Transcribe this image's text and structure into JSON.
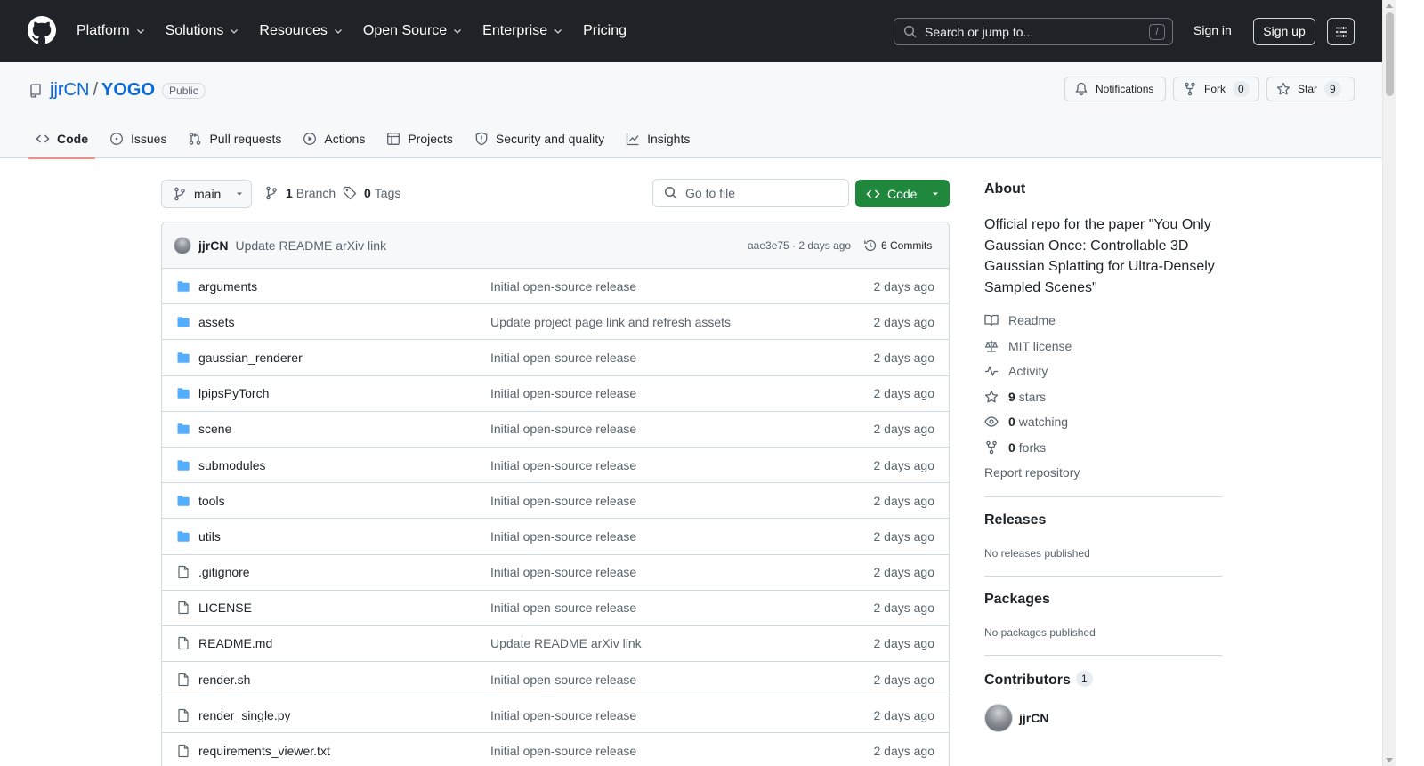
{
  "header": {
    "nav": [
      {
        "label": "Platform",
        "dropdown": true
      },
      {
        "label": "Solutions",
        "dropdown": true
      },
      {
        "label": "Resources",
        "dropdown": true
      },
      {
        "label": "Open Source",
        "dropdown": true
      },
      {
        "label": "Enterprise",
        "dropdown": true
      },
      {
        "label": "Pricing",
        "dropdown": false
      }
    ],
    "search_placeholder": "Search or jump to...",
    "search_shortcut": "/",
    "sign_in": "Sign in",
    "sign_up": "Sign up"
  },
  "repo": {
    "owner": "jjrCN",
    "separator": "/",
    "name": "YOGO",
    "visibility": "Public",
    "notifications_label": "Notifications",
    "fork_label": "Fork",
    "fork_count": "0",
    "star_label": "Star",
    "star_count": "9"
  },
  "tabs": [
    {
      "label": "Code",
      "icon": "code-icon",
      "active": true
    },
    {
      "label": "Issues",
      "icon": "issue-icon",
      "active": false
    },
    {
      "label": "Pull requests",
      "icon": "pull-request-icon",
      "active": false
    },
    {
      "label": "Actions",
      "icon": "play-icon",
      "active": false
    },
    {
      "label": "Projects",
      "icon": "table-icon",
      "active": false
    },
    {
      "label": "Security and quality",
      "icon": "shield-icon",
      "active": false
    },
    {
      "label": "Insights",
      "icon": "graph-icon",
      "active": false
    }
  ],
  "toolbar": {
    "branch": "main",
    "branch_count": "1",
    "branch_label": "Branch",
    "tag_count": "0",
    "tag_label": "Tags",
    "goto_placeholder": "Go to file",
    "code_label": "Code"
  },
  "commit": {
    "author": "jjrCN",
    "message": "Update README arXiv link",
    "hash_time": "aae3e75 · 2 days ago",
    "commits": "6 Commits"
  },
  "files": [
    {
      "name": "arguments",
      "type": "dir",
      "message": "Initial open-source release",
      "date": "2 days ago"
    },
    {
      "name": "assets",
      "type": "dir",
      "message": "Update project page link and refresh assets",
      "date": "2 days ago"
    },
    {
      "name": "gaussian_renderer",
      "type": "dir",
      "message": "Initial open-source release",
      "date": "2 days ago"
    },
    {
      "name": "lpipsPyTorch",
      "type": "dir",
      "message": "Initial open-source release",
      "date": "2 days ago"
    },
    {
      "name": "scene",
      "type": "dir",
      "message": "Initial open-source release",
      "date": "2 days ago"
    },
    {
      "name": "submodules",
      "type": "dir",
      "message": "Initial open-source release",
      "date": "2 days ago"
    },
    {
      "name": "tools",
      "type": "dir",
      "message": "Initial open-source release",
      "date": "2 days ago"
    },
    {
      "name": "utils",
      "type": "dir",
      "message": "Initial open-source release",
      "date": "2 days ago"
    },
    {
      "name": ".gitignore",
      "type": "file",
      "message": "Initial open-source release",
      "date": "2 days ago"
    },
    {
      "name": "LICENSE",
      "type": "file",
      "message": "Initial open-source release",
      "date": "2 days ago"
    },
    {
      "name": "README.md",
      "type": "file",
      "message": "Update README arXiv link",
      "date": "2 days ago"
    },
    {
      "name": "render.sh",
      "type": "file",
      "message": "Initial open-source release",
      "date": "2 days ago"
    },
    {
      "name": "render_single.py",
      "type": "file",
      "message": "Initial open-source release",
      "date": "2 days ago"
    },
    {
      "name": "requirements_viewer.txt",
      "type": "file",
      "message": "Initial open-source release",
      "date": "2 days ago"
    }
  ],
  "about": {
    "title": "About",
    "description": "Official repo for the paper \"You Only Gaussian Once: Controllable 3D Gaussian Splatting for Ultra-Densely Sampled Scenes\"",
    "items": [
      {
        "icon": "book-icon",
        "bold": "",
        "label": "Readme"
      },
      {
        "icon": "law-icon",
        "bold": "",
        "label": "MIT license"
      },
      {
        "icon": "pulse-icon",
        "bold": "",
        "label": "Activity"
      },
      {
        "icon": "star-icon",
        "bold": "9",
        "label": "stars"
      },
      {
        "icon": "eye-icon",
        "bold": "0",
        "label": "watching"
      },
      {
        "icon": "fork-icon",
        "bold": "0",
        "label": "forks"
      }
    ],
    "report": "Report repository"
  },
  "releases": {
    "title": "Releases",
    "text": "No releases published"
  },
  "packages": {
    "title": "Packages",
    "text": "No packages published"
  },
  "contributors": {
    "title": "Contributors",
    "count": "1",
    "name": "jjrCN"
  },
  "colors": {
    "header_bg": "#1f2328",
    "link": "#0969da",
    "green": "#1f883d",
    "folder": "#54aeff",
    "active_tab": "#fd8c73"
  }
}
